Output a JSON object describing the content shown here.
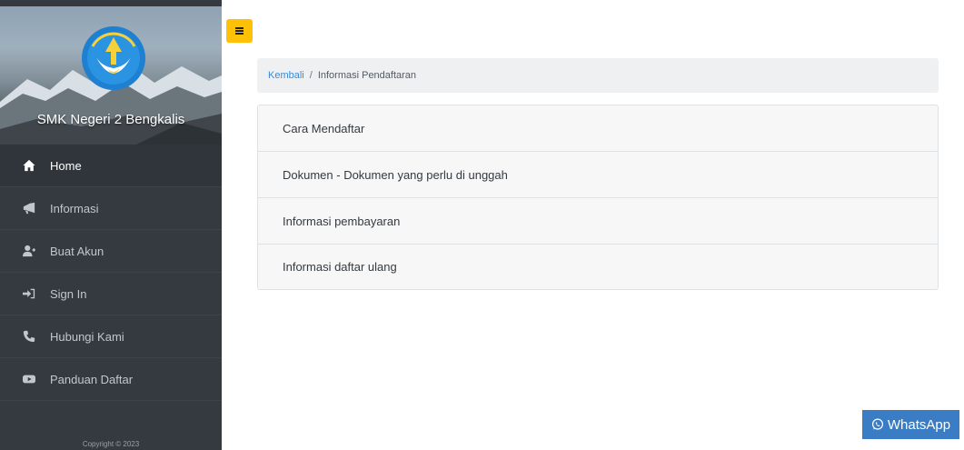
{
  "sidebar": {
    "school_name": "SMK Negeri 2 Bengkalis",
    "logo_text": "TUT WURI HANDAYANI",
    "items": [
      {
        "label": "Home",
        "icon": "home-icon",
        "active": true
      },
      {
        "label": "Informasi",
        "icon": "megaphone-icon",
        "active": false
      },
      {
        "label": "Buat Akun",
        "icon": "user-plus-icon",
        "active": false
      },
      {
        "label": "Sign In",
        "icon": "sign-in-icon",
        "active": false
      },
      {
        "label": "Hubungi Kami",
        "icon": "phone-icon",
        "active": false
      },
      {
        "label": "Panduan Daftar",
        "icon": "youtube-icon",
        "active": false
      }
    ],
    "copyright": "Copyright © 2023"
  },
  "toggle": {
    "icon": "hamburger-icon",
    "color": "#ffc107"
  },
  "breadcrumb": {
    "link": "Kembali",
    "separator": "/",
    "current": "Informasi Pendaftaran"
  },
  "accordion": [
    {
      "label": "Cara Mendaftar"
    },
    {
      "label": "Dokumen - Dokumen yang perlu di unggah"
    },
    {
      "label": "Informasi pembayaran"
    },
    {
      "label": "Informasi daftar ulang"
    }
  ],
  "whatsapp": {
    "label": "WhatsApp",
    "icon": "whatsapp-icon",
    "color": "#3b7dc4"
  },
  "colors": {
    "sidebar_bg": "#343a40",
    "link": "#3a8bd6",
    "breadcrumb_bg": "#eef0f2"
  }
}
